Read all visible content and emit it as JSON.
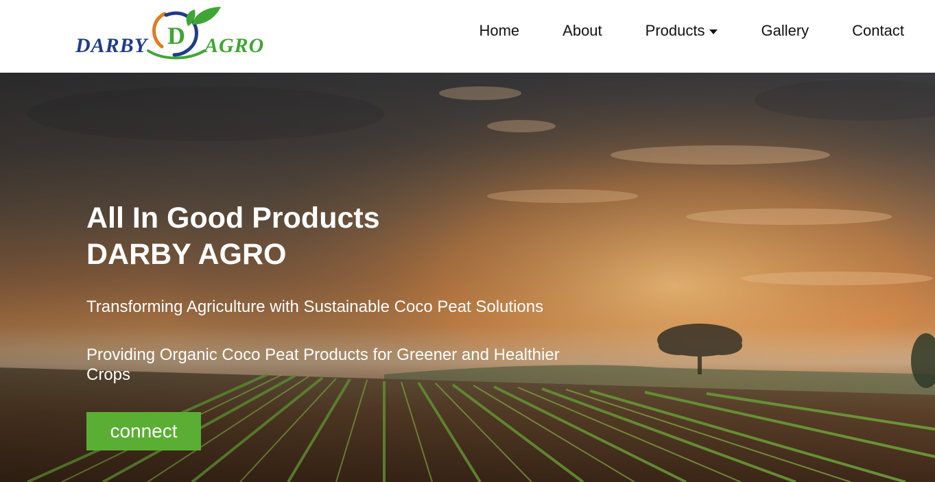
{
  "brand": {
    "name_part1": "DARBY",
    "name_part2": "AGRO",
    "monogram": "D",
    "colors": {
      "navy": "#1f3c88",
      "green": "#3fa535",
      "orange": "#e07b1f"
    }
  },
  "nav": {
    "items": [
      {
        "label": "Home"
      },
      {
        "label": "About"
      },
      {
        "label": "Products",
        "has_dropdown": true
      },
      {
        "label": "Gallery"
      },
      {
        "label": "Contact"
      }
    ]
  },
  "hero": {
    "title_line1": "All In Good Products",
    "title_line2": "DARBY AGRO",
    "subtitle": "Transforming Agriculture with Sustainable Coco Peat Solutions",
    "description": "Providing Organic Coco Peat Products for Greener and Healthier Crops",
    "cta_label": "connect",
    "cta_color": "#5aae33",
    "background": "sunset-farm-field"
  }
}
